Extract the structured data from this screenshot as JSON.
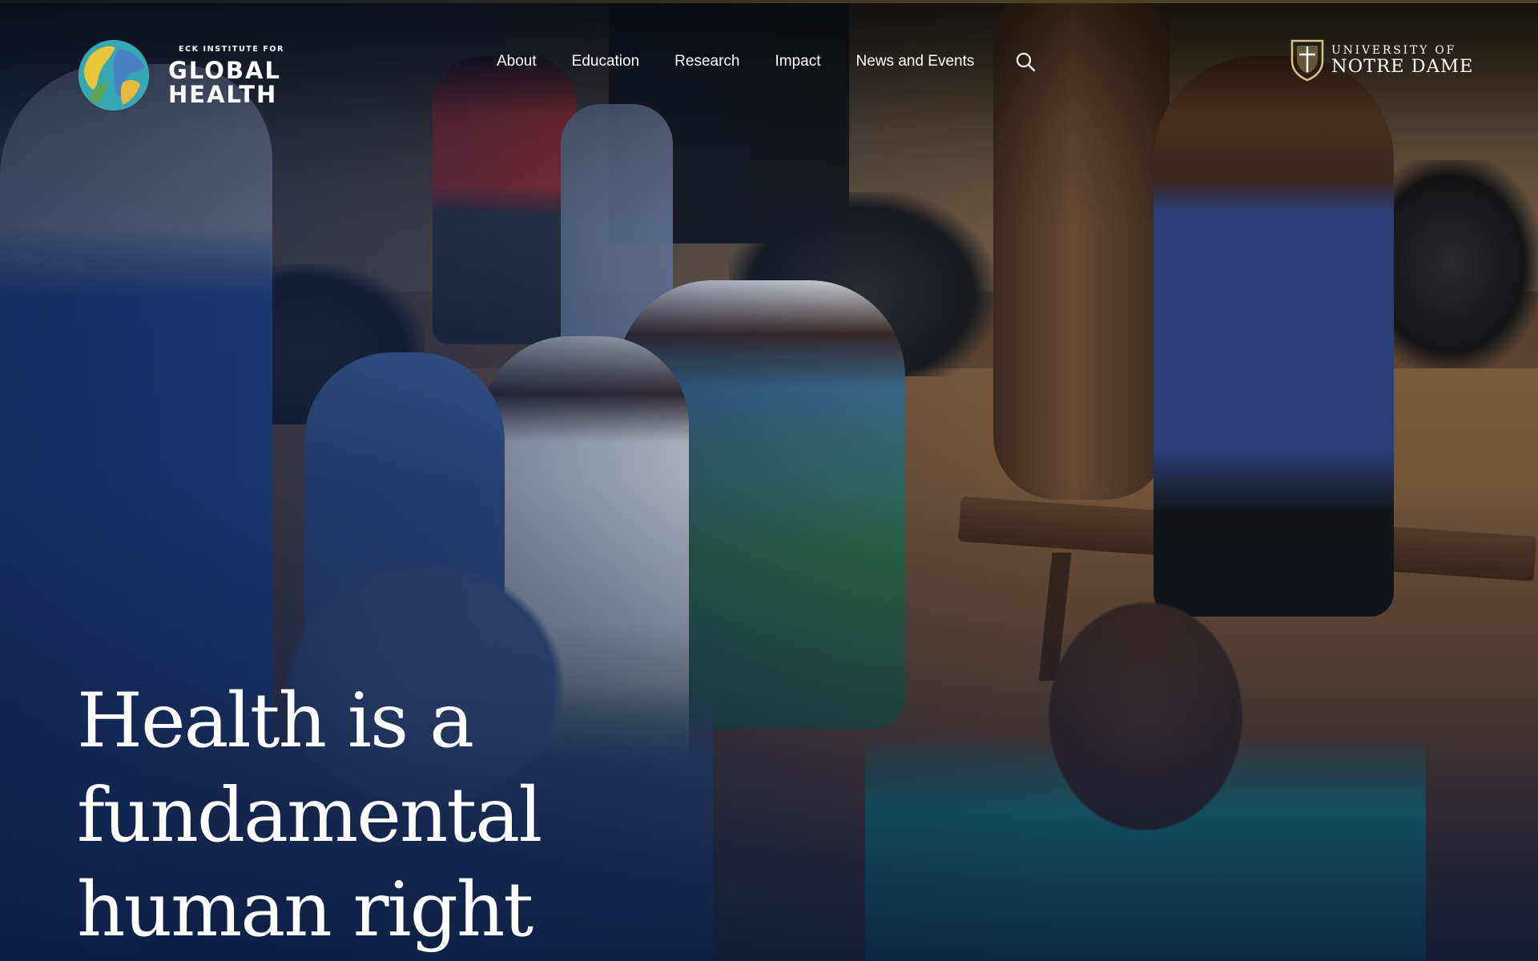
{
  "brand": {
    "kicker": "ECK INSTITUTE FOR",
    "line1": "GLOBAL",
    "line2": "HEALTH",
    "logo_icon": "globe-logo"
  },
  "nav": {
    "items": [
      {
        "label": "About"
      },
      {
        "label": "Education"
      },
      {
        "label": "Research"
      },
      {
        "label": "Impact"
      },
      {
        "label": "News and Events"
      }
    ],
    "search_icon": "search-icon"
  },
  "university": {
    "line1": "UNIVERSITY OF",
    "line2": "NOTRE DAME",
    "shield_icon": "nd-shield-icon"
  },
  "hero": {
    "title_line1": "Health is a fundamental",
    "title_line2": "human right"
  },
  "colors": {
    "top_rule": "#a89356",
    "brand_blue": "#2a3d78",
    "globe_yellow": "#e8c53a",
    "globe_teal": "#35a7b5",
    "globe_blue": "#4a7fc4",
    "globe_green": "#5aa55a"
  }
}
